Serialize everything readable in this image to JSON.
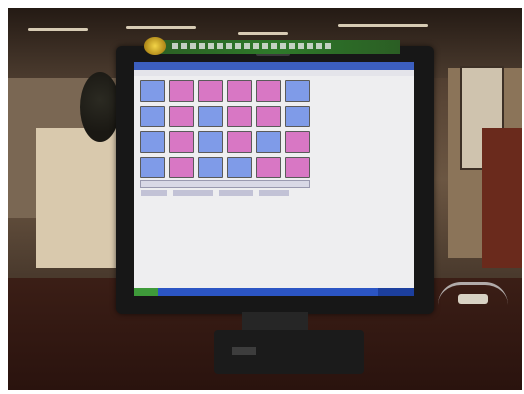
{
  "scene": {
    "description_tags": [
      "monitor",
      "library_kiosk",
      "grid_of_buttons"
    ],
    "colors": {
      "tile_blue": "#7f9be8",
      "tile_pink": "#d877c4",
      "screen_bg": "#eeeef0",
      "banner_green": "#2e7a2a",
      "taskbar": "#2b55c4"
    }
  },
  "tiles": [
    [
      "blue",
      "pink",
      "pink",
      "pink",
      "pink",
      "blue"
    ],
    [
      "blue",
      "pink",
      "blue",
      "pink",
      "pink",
      "blue"
    ],
    [
      "blue",
      "pink",
      "blue",
      "pink",
      "blue",
      "pink"
    ],
    [
      "blue",
      "pink",
      "blue",
      "blue",
      "pink",
      "pink"
    ]
  ]
}
